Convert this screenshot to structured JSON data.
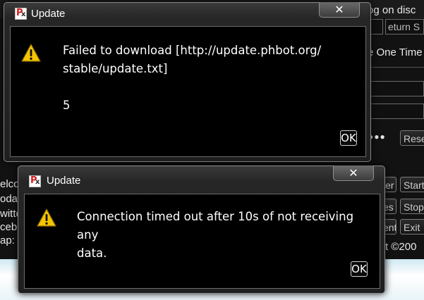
{
  "background": {
    "top_right_text": "og on disc",
    "return_field": "eturn S",
    "one_time_text": "e One Time",
    "password_dots": "●●●",
    "reset_button": "Rese",
    "side_labels": [
      "elco",
      "odat",
      "witte",
      "ceb",
      "ap:"
    ],
    "right_buttons": [
      "Start",
      "Stop",
      "Exit"
    ],
    "right_buttons_partial": [
      "ler",
      "es",
      "ent"
    ],
    "copyright_text": "t ©200"
  },
  "dialogs": [
    {
      "title": "Update",
      "message": "Failed to download [http://update.phbot.org/\nstable/update.txt]\n\n5",
      "ok_label": "OK",
      "close_glyph": "✕"
    },
    {
      "title": "Update",
      "message": "Connection timed out after 10s of not receiving any\ndata.",
      "ok_label": "OK",
      "close_glyph": "✕"
    }
  ],
  "icons": {
    "app": "phbot-app-icon",
    "warning": "warning-icon",
    "close": "close-icon"
  },
  "colors": {
    "dialog_body": "#000000",
    "warning_yellow": "#f5c400"
  }
}
